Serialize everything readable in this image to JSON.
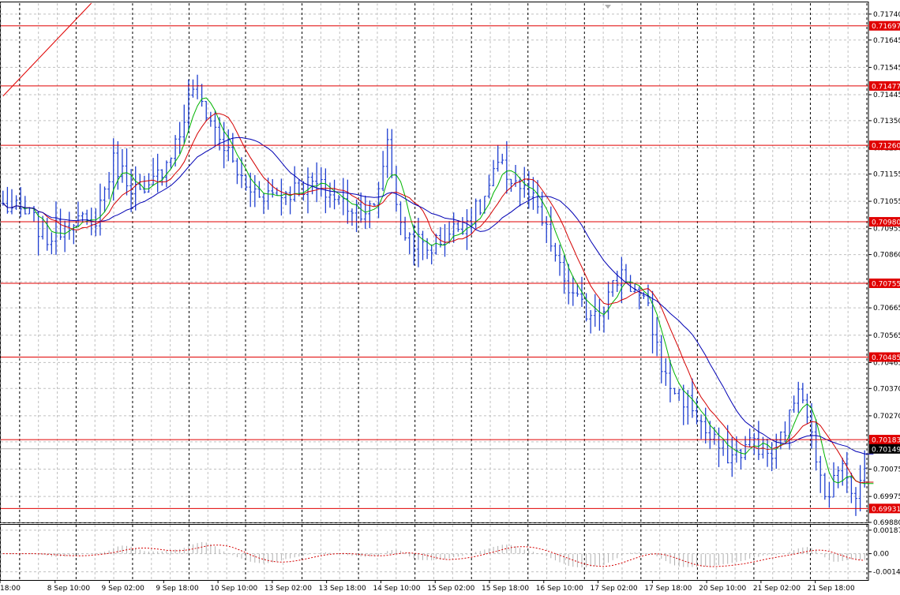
{
  "chart_data": {
    "type": "candlestick",
    "panels": [
      "price",
      "oscillator"
    ],
    "price_axis": {
      "ylim": [
        0.6988,
        0.7178
      ],
      "ticks": [
        "0.71740",
        "0.71645",
        "0.71545",
        "0.71445",
        "0.71350",
        "0.71250",
        "0.71155",
        "0.71055",
        "0.70955",
        "0.70860",
        "0.70760",
        "0.70665",
        "0.70565",
        "0.70465",
        "0.70370",
        "0.70270",
        "0.70175",
        "0.70075",
        "0.69975",
        "0.69880"
      ]
    },
    "oscillator_axis": {
      "ylim": [
        -0.0021,
        0.0023
      ],
      "ticks": [
        "0.001871",
        "0.00",
        "-0.00145"
      ]
    },
    "x_labels": [
      "18:00",
      "8 Sep 10:00",
      "9 Sep 02:00",
      "9 Sep 18:00",
      "10 Sep 10:00",
      "13 Sep 02:00",
      "13 Sep 18:00",
      "14 Sep 10:00",
      "15 Sep 02:00",
      "15 Sep 18:00",
      "16 Sep 10:00",
      "17 Sep 02:00",
      "17 Sep 18:00",
      "20 Sep 10:00",
      "21 Sep 02:00",
      "21 Sep 18:00"
    ],
    "bar_count": 196,
    "trendline": {
      "x": [
        0,
        20
      ],
      "y": [
        0.7144,
        0.7178
      ]
    },
    "levels": [
      {
        "value": 0.71697,
        "label": "0.71697"
      },
      {
        "value": 0.71477,
        "label": "0.71477"
      },
      {
        "value": 0.7126,
        "label": "0.71260"
      },
      {
        "value": 0.7098,
        "label": "0.70980"
      },
      {
        "value": 0.70755,
        "label": "0.70755"
      },
      {
        "value": 0.70485,
        "label": "0.70485"
      },
      {
        "value": 0.70183,
        "label": "0.70183"
      },
      {
        "value": 0.69931,
        "label": "0.69931"
      }
    ],
    "current_price": {
      "value": 0.70149,
      "label": "0.70149"
    },
    "price_path": [
      [
        0,
        0.7104
      ],
      [
        6,
        0.71
      ],
      [
        10,
        0.7092
      ],
      [
        16,
        0.71
      ],
      [
        20,
        0.7095
      ],
      [
        25,
        0.712
      ],
      [
        32,
        0.7106
      ],
      [
        40,
        0.713
      ],
      [
        43,
        0.7148
      ],
      [
        48,
        0.7132
      ],
      [
        55,
        0.711
      ],
      [
        62,
        0.7108
      ],
      [
        70,
        0.7112
      ],
      [
        78,
        0.7104
      ],
      [
        84,
        0.7102
      ],
      [
        87,
        0.7128
      ],
      [
        90,
        0.7095
      ],
      [
        96,
        0.7088
      ],
      [
        102,
        0.7095
      ],
      [
        108,
        0.7103
      ],
      [
        112,
        0.7118
      ],
      [
        116,
        0.7113
      ],
      [
        120,
        0.7105
      ],
      [
        124,
        0.709
      ],
      [
        126,
        0.708
      ],
      [
        129,
        0.707
      ],
      [
        132,
        0.7065
      ],
      [
        136,
        0.7068
      ],
      [
        140,
        0.708
      ],
      [
        146,
        0.7065
      ],
      [
        150,
        0.704
      ],
      [
        156,
        0.703
      ],
      [
        160,
        0.7018
      ],
      [
        165,
        0.7012
      ],
      [
        170,
        0.7018
      ],
      [
        174,
        0.7012
      ],
      [
        178,
        0.7026
      ],
      [
        180,
        0.704
      ],
      [
        182,
        0.703
      ],
      [
        184,
        0.7008
      ],
      [
        187,
        0.6998
      ],
      [
        190,
        0.7012
      ],
      [
        193,
        0.6996
      ],
      [
        196,
        0.7016
      ]
    ],
    "series": [
      {
        "type": "ohlc",
        "color": "#1f3fd0"
      },
      {
        "type": "moving_average",
        "color": "#00b400",
        "period": 5
      },
      {
        "type": "moving_average",
        "color": "#d40000",
        "period": 10
      },
      {
        "type": "moving_average",
        "color": "#0000b4",
        "period": 20
      },
      {
        "type": "oscillator_histogram",
        "color": "#b0b0b0"
      },
      {
        "type": "oscillator_signal",
        "color": "#d40000",
        "style": "dashed"
      }
    ],
    "grid": true
  },
  "colors": {
    "background": "#ffffff",
    "grid": "#c0c0c0",
    "level": "#e00000",
    "level_label_bg": "#e00000",
    "current_label_bg": "#000000",
    "axis_text": "#000000"
  }
}
